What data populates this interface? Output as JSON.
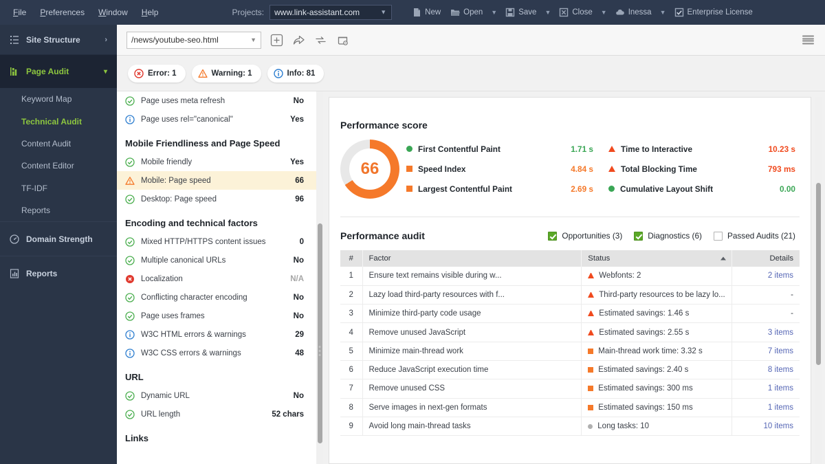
{
  "menubar": {
    "items": [
      "File",
      "Preferences",
      "Window",
      "Help"
    ],
    "projects_label": "Projects:",
    "project_value": "www.link-assistant.com",
    "tools": [
      {
        "label": "New",
        "icon": "file-icon",
        "caret": false
      },
      {
        "label": "Open",
        "icon": "folder-open-icon",
        "caret": true
      },
      {
        "label": "Save",
        "icon": "floppy-disk-icon",
        "caret": true
      },
      {
        "label": "Close",
        "icon": "close-box-icon",
        "caret": true
      },
      {
        "label": "Inessa",
        "icon": "cloud-icon",
        "caret": true
      },
      {
        "label": "Enterprise License",
        "icon": "checkbox-icon",
        "caret": false
      }
    ]
  },
  "sidebar": {
    "site_structure": "Site Structure",
    "page_audit": "Page Audit",
    "sub_items": [
      "Keyword Map",
      "Technical Audit",
      "Content Audit",
      "Content Editor",
      "TF-IDF",
      "Reports"
    ],
    "selected_sub": "Technical Audit",
    "domain_strength": "Domain Strength",
    "reports": "Reports"
  },
  "urlbar": {
    "url": "/news/youtube-seo.html",
    "icons": [
      "add-page-icon",
      "share-icon",
      "refresh-icon",
      "rescan-icon"
    ],
    "menu_icon": "hamburger-menu-icon"
  },
  "chips": [
    {
      "label": "Error: 1",
      "icon": "error-icon",
      "color": "#e03a2f"
    },
    {
      "label": "Warning: 1",
      "icon": "warning-icon",
      "color": "#f5792a"
    },
    {
      "label": "Info: 81",
      "icon": "info-icon",
      "color": "#2f7fd0"
    }
  ],
  "factors": [
    {
      "type": "row",
      "status": "ok",
      "name": "Page uses meta refresh",
      "value": "No"
    },
    {
      "type": "row",
      "status": "info",
      "name": "Page uses rel=\"canonical\"",
      "value": "Yes"
    },
    {
      "type": "head",
      "name": "Mobile Friendliness and Page Speed"
    },
    {
      "type": "row",
      "status": "ok",
      "name": "Mobile friendly",
      "value": "Yes"
    },
    {
      "type": "row",
      "status": "warn",
      "name": "Mobile: Page speed",
      "value": "66",
      "highlight": true
    },
    {
      "type": "row",
      "status": "ok",
      "name": "Desktop: Page speed",
      "value": "96"
    },
    {
      "type": "head",
      "name": "Encoding and technical factors"
    },
    {
      "type": "row",
      "status": "ok",
      "name": "Mixed HTTP/HTTPS content issues",
      "value": "0"
    },
    {
      "type": "row",
      "status": "ok",
      "name": "Multiple canonical URLs",
      "value": "No"
    },
    {
      "type": "row",
      "status": "error",
      "name": "Localization",
      "value": "N/A",
      "na": true
    },
    {
      "type": "row",
      "status": "ok",
      "name": "Conflicting character encoding",
      "value": "No"
    },
    {
      "type": "row",
      "status": "ok",
      "name": "Page uses frames",
      "value": "No"
    },
    {
      "type": "row",
      "status": "info",
      "name": "W3C HTML errors & warnings",
      "value": "29"
    },
    {
      "type": "row",
      "status": "info",
      "name": "W3C CSS errors & warnings",
      "value": "48"
    },
    {
      "type": "head",
      "name": "URL"
    },
    {
      "type": "row",
      "status": "ok",
      "name": "Dynamic URL",
      "value": "No"
    },
    {
      "type": "row",
      "status": "ok",
      "name": "URL length",
      "value": "52 chars"
    },
    {
      "type": "head",
      "name": "Links"
    }
  ],
  "performance": {
    "title": "Performance score",
    "score": "66",
    "score_pct": 66,
    "score_color": "#f5792a",
    "track_color": "#e8e8e8",
    "metrics": [
      {
        "label": "First Contentful Paint",
        "value": "1.71 s",
        "marker": "dot",
        "color": "#3aa655",
        "value_color": "#3aa655"
      },
      {
        "label": "Speed Index",
        "value": "4.84 s",
        "marker": "square",
        "color": "#f5792a",
        "value_color": "#f5792a"
      },
      {
        "label": "Largest Contentful Paint",
        "value": "2.69 s",
        "marker": "square",
        "color": "#f5792a",
        "value_color": "#f5792a"
      },
      {
        "label": "Time to Interactive",
        "value": "10.23 s",
        "marker": "triangle",
        "color": "#f04a1e",
        "value_color": "#f04a1e"
      },
      {
        "label": "Total Blocking Time",
        "value": "793 ms",
        "marker": "triangle",
        "color": "#f04a1e",
        "value_color": "#f04a1e"
      },
      {
        "label": "Cumulative Layout Shift",
        "value": "0.00",
        "marker": "dot",
        "color": "#3aa655",
        "value_color": "#3aa655"
      }
    ]
  },
  "audit": {
    "title": "Performance audit",
    "filters": [
      {
        "label": "Opportunities (3)",
        "checked": true
      },
      {
        "label": "Diagnostics (6)",
        "checked": true
      },
      {
        "label": "Passed Audits (21)",
        "checked": false
      }
    ],
    "columns": {
      "num": "#",
      "factor": "Factor",
      "status": "Status",
      "details": "Details"
    },
    "sorted_column": "Status",
    "sort_direction": "asc",
    "rows": [
      {
        "num": "1",
        "factor": "Ensure text remains visible during w...",
        "marker": "triangle",
        "marker_color": "#f04a1e",
        "status": "Webfonts: 2",
        "details": "2 items",
        "link": true
      },
      {
        "num": "2",
        "factor": "Lazy load third-party resources with f...",
        "marker": "triangle",
        "marker_color": "#f04a1e",
        "status": "Third-party resources to be lazy lo...",
        "details": "-",
        "link": false
      },
      {
        "num": "3",
        "factor": "Minimize third-party code usage",
        "marker": "triangle",
        "marker_color": "#f04a1e",
        "status": "Estimated savings: 1.46 s",
        "details": "-",
        "link": false
      },
      {
        "num": "4",
        "factor": "Remove unused JavaScript",
        "marker": "triangle",
        "marker_color": "#f04a1e",
        "status": "Estimated savings: 2.55 s",
        "details": "3 items",
        "link": true
      },
      {
        "num": "5",
        "factor": "Minimize main-thread work",
        "marker": "square",
        "marker_color": "#f5792a",
        "status": "Main-thread work time: 3.32 s",
        "details": "7 items",
        "link": true
      },
      {
        "num": "6",
        "factor": "Reduce JavaScript execution time",
        "marker": "square",
        "marker_color": "#f5792a",
        "status": "Estimated savings: 2.40 s",
        "details": "8 items",
        "link": true
      },
      {
        "num": "7",
        "factor": "Remove unused CSS",
        "marker": "square",
        "marker_color": "#f5792a",
        "status": "Estimated savings: 300 ms",
        "details": "1 items",
        "link": true
      },
      {
        "num": "8",
        "factor": "Serve images in next-gen formats",
        "marker": "square",
        "marker_color": "#f5792a",
        "status": "Estimated savings: 150 ms",
        "details": "1 items",
        "link": true
      },
      {
        "num": "9",
        "factor": "Avoid long main-thread tasks",
        "marker": "dot",
        "marker_color": "#b0b0b0",
        "status": "Long tasks: 10",
        "details": "10 items",
        "link": true
      }
    ]
  }
}
